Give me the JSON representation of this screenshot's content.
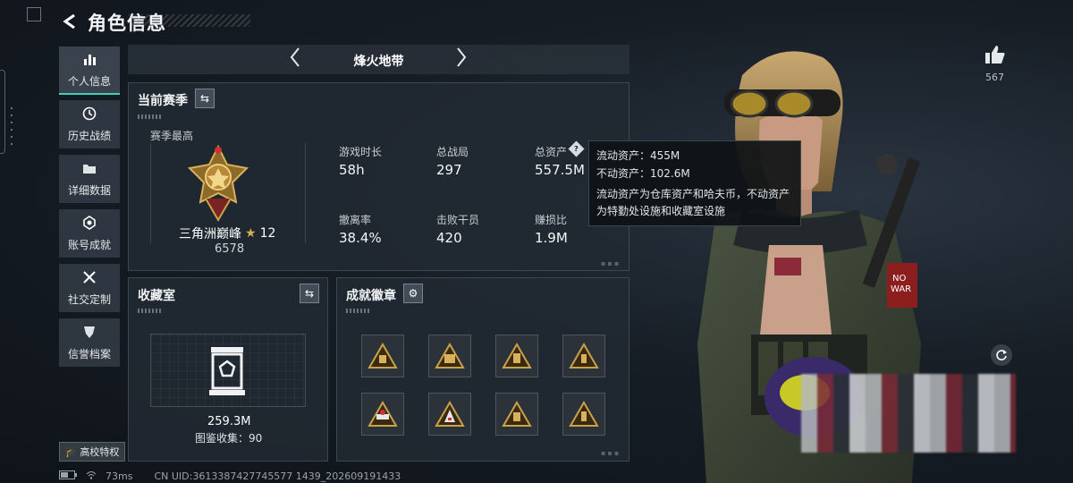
{
  "header": {
    "title": "角色信息"
  },
  "sidebar": {
    "items": [
      {
        "label": "个人信息",
        "icon": "bar-chart-icon",
        "active": true
      },
      {
        "label": "历史战绩",
        "icon": "history-icon"
      },
      {
        "label": "详细数据",
        "icon": "folder-icon"
      },
      {
        "label": "账号成就",
        "icon": "achievement-icon"
      },
      {
        "label": "社交定制",
        "icon": "tools-icon"
      },
      {
        "label": "信誉档案",
        "icon": "credit-shield-icon"
      }
    ],
    "school_label": "高校特权"
  },
  "season_bar": {
    "name": "烽火地带"
  },
  "current_season": {
    "title": "当前赛季",
    "best_label": "赛季最高",
    "rank_name": "三角洲巅峰",
    "rank_stars": "12",
    "rank_score": "6578",
    "stats": [
      {
        "label": "游戏时长",
        "value": "58h"
      },
      {
        "label": "总战局",
        "value": "297"
      },
      {
        "label": "总资产",
        "value": "557.5M"
      },
      {
        "label": "撤离率",
        "value": "38.4%"
      },
      {
        "label": "击败干员",
        "value": "420"
      },
      {
        "label": "赚损比",
        "value": "1.9M"
      }
    ]
  },
  "tooltip": {
    "liquid": "流动资产：455M",
    "fixed": "不动资产：102.6M",
    "desc_line1": "流动资产为仓库资产和哈夫币，不动资产",
    "desc_line2": "为特勤处设施和收藏室设施"
  },
  "collection": {
    "title": "收藏室",
    "value": "259.3M",
    "collect_text": "图鉴收集：90"
  },
  "achievements": {
    "title": "成就徽章",
    "badges": [
      "badge-1",
      "badge-2",
      "badge-3",
      "badge-4",
      "badge-5",
      "badge-6",
      "badge-7",
      "badge-8"
    ]
  },
  "likes": {
    "count": "567"
  },
  "status": {
    "ping": "73ms",
    "uid": "CN UID:3613387427745577 1439_202609191433"
  },
  "colors": {
    "accent": "#3fd0b8",
    "gold": "#c9a24a"
  }
}
